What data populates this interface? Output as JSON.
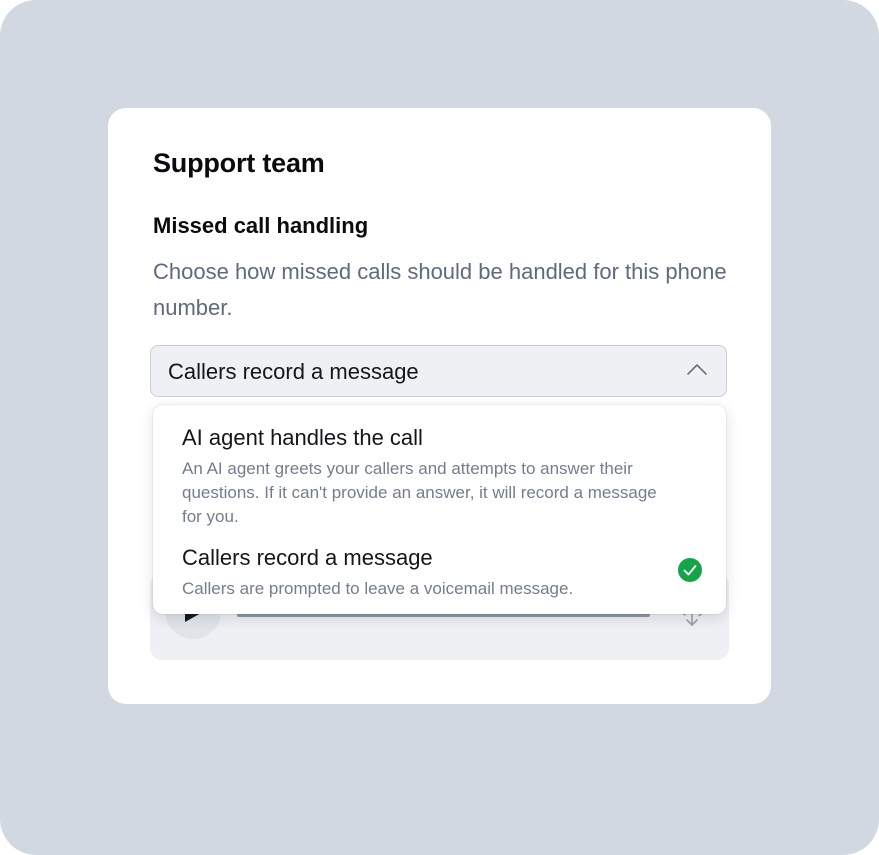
{
  "card": {
    "title": "Support team"
  },
  "missed_call": {
    "heading": "Missed call handling",
    "description": "Choose how missed calls should be handled for this phone number.",
    "selected_value": "Callers record a message",
    "options": [
      {
        "title": "AI agent handles the call",
        "description": "An AI agent greets your callers and attempts to answer their questions. If it can't provide an answer, it will record a message for you.",
        "selected": false
      },
      {
        "title": "Callers record a message",
        "description": "Callers are prompted to leave a voicemail message.",
        "selected": true
      }
    ]
  },
  "icons": {
    "select_chevron": "chevron-up-icon",
    "selected_check": "check-circle-icon",
    "play": "play-icon",
    "download": "cloud-download-icon"
  },
  "colors": {
    "background": "#d2d8e2",
    "card": "#ffffff",
    "select_bg": "#eff0f4",
    "check_green": "#17a34a",
    "muted_text": "#5f6a7d"
  }
}
